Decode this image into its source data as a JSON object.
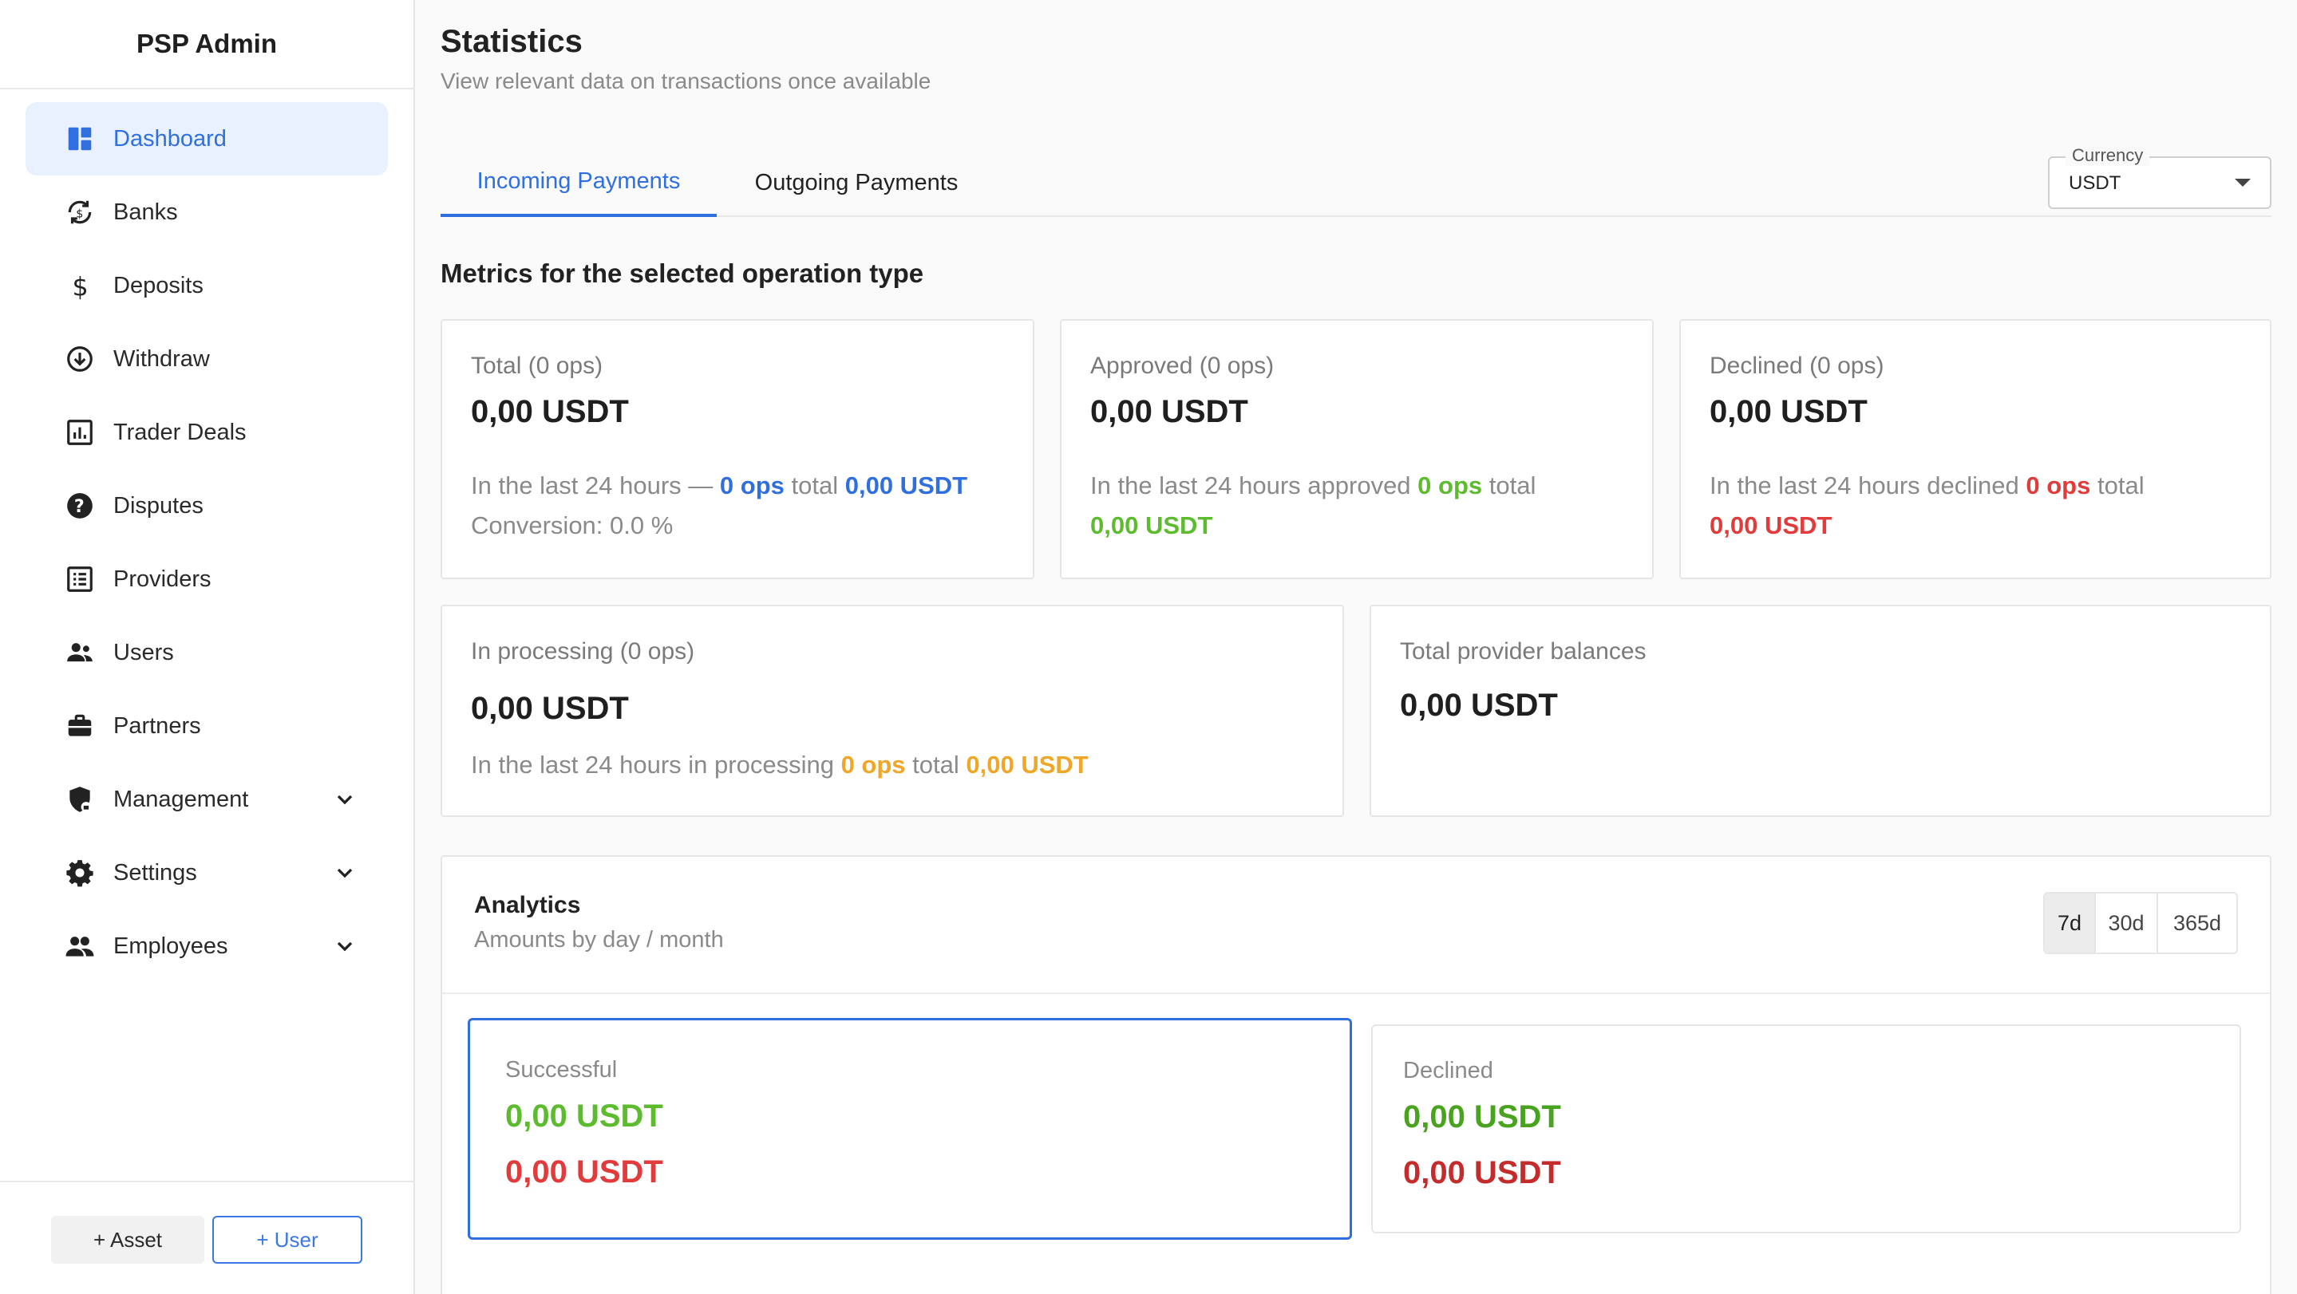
{
  "app": {
    "title": "PSP Admin"
  },
  "sidebar": {
    "items": [
      {
        "label": "Dashboard",
        "icon": "dashboard-icon",
        "active": true
      },
      {
        "label": "Banks",
        "icon": "bank-sync-icon"
      },
      {
        "label": "Deposits",
        "icon": "dollar-icon"
      },
      {
        "label": "Withdraw",
        "icon": "arrow-down-circle-icon"
      },
      {
        "label": "Trader Deals",
        "icon": "bar-chart-icon"
      },
      {
        "label": "Disputes",
        "icon": "help-circle-icon"
      },
      {
        "label": "Providers",
        "icon": "grid-list-icon"
      },
      {
        "label": "Users",
        "icon": "users-icon"
      },
      {
        "label": "Partners",
        "icon": "briefcase-icon"
      },
      {
        "label": "Management",
        "icon": "shield-lock-icon",
        "expandable": true
      },
      {
        "label": "Settings",
        "icon": "gear-icon",
        "expandable": true
      },
      {
        "label": "Employees",
        "icon": "group-icon",
        "expandable": true
      }
    ],
    "footer": {
      "asset_button": "+ Asset",
      "user_button": "+ User"
    }
  },
  "header": {
    "title": "Statistics",
    "subtitle": "View relevant data on transactions once available"
  },
  "tabs": [
    {
      "label": "Incoming Payments",
      "active": true
    },
    {
      "label": "Outgoing Payments",
      "active": false
    }
  ],
  "currency": {
    "label": "Currency",
    "value": "USDT"
  },
  "metrics": {
    "title": "Metrics for the selected operation type",
    "total": {
      "label": "Total (0 ops)",
      "value": "0,00 USDT",
      "desc_prefix": "In the last 24 hours —",
      "ops": "0 ops",
      "desc_mid": "total",
      "amount": "0,00 USDT",
      "conversion": "Conversion: 0.0 %"
    },
    "approved": {
      "label": "Approved (0 ops)",
      "value": "0,00 USDT",
      "desc_prefix": "In the last 24 hours approved",
      "ops": "0 ops",
      "desc_mid": "total",
      "amount": "0,00 USDT"
    },
    "declined": {
      "label": "Declined (0 ops)",
      "value": "0,00 USDT",
      "desc_prefix": "In the last 24 hours declined",
      "ops": "0 ops",
      "desc_mid": "total",
      "amount": "0,00 USDT"
    },
    "processing": {
      "label": "In processing (0 ops)",
      "value": "0,00 USDT",
      "desc_prefix": "In the last 24 hours in processing",
      "ops": "0 ops",
      "desc_mid": "total",
      "amount": "0,00 USDT"
    },
    "provider_balances": {
      "label": "Total provider balances",
      "value": "0,00 USDT"
    }
  },
  "analytics": {
    "title": "Analytics",
    "subtitle": "Amounts by day / month",
    "ranges": [
      {
        "label": "7d",
        "selected": true
      },
      {
        "label": "30d",
        "selected": false
      },
      {
        "label": "365d",
        "selected": false
      }
    ],
    "successful": {
      "label": "Successful",
      "value_green": "0,00 USDT",
      "value_red": "0,00 USDT"
    },
    "declined": {
      "label": "Declined",
      "value_green": "0,00 USDT",
      "value_red": "0,00 USDT"
    }
  },
  "colors": {
    "accent": "#2f6fe0",
    "green": "#5cbc2e",
    "red": "#e23b3b",
    "orange": "#f0a626"
  }
}
